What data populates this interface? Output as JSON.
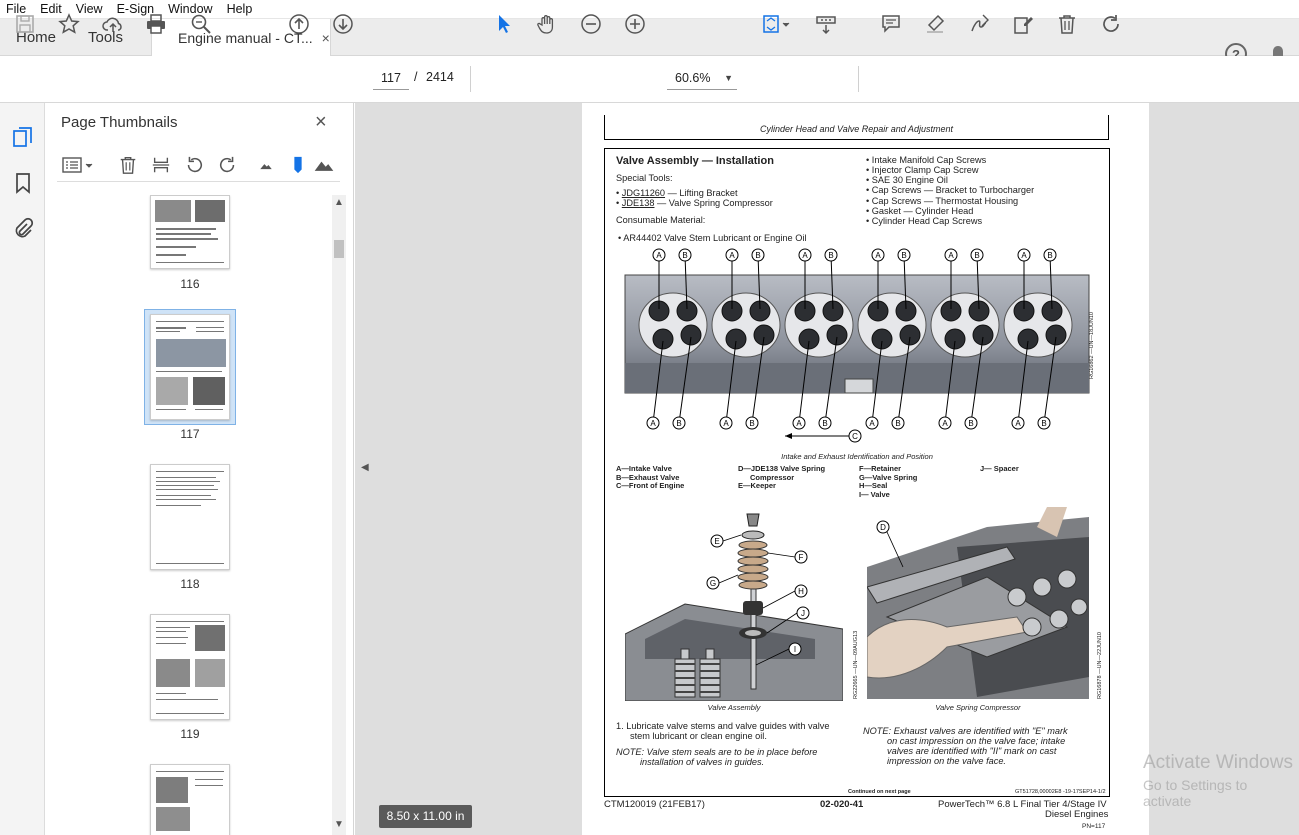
{
  "menu": [
    "File",
    "Edit",
    "View",
    "E-Sign",
    "Window",
    "Help"
  ],
  "tabs": {
    "home": "Home",
    "tools": "Tools",
    "document": "Engine manual - CT...",
    "close": "×"
  },
  "toolbar": {
    "current_page": "117",
    "page_sep": "/",
    "total_pages": "2414",
    "zoom": "60.6%"
  },
  "panel": {
    "title": "Page Thumbnails",
    "close": "×",
    "thumbnails": [
      {
        "label": "116",
        "selected": false
      },
      {
        "label": "117",
        "selected": true
      },
      {
        "label": "118",
        "selected": false
      },
      {
        "label": "119",
        "selected": false
      }
    ]
  },
  "viewer": {
    "page_size": "8.50 x 11.00 in"
  },
  "document": {
    "header": "Cylinder Head and Valve Repair and Adjustment",
    "section_title": "Valve Assembly — Installation",
    "special_tools_label": "Special Tools:",
    "tools": [
      {
        "code": "JDG11260",
        "desc": " — Lifting Bracket"
      },
      {
        "code": "JDE138",
        "desc": " — Valve Spring Compressor"
      }
    ],
    "consumable_label": "Consumable Material:",
    "consumable": "• AR44402 Valve Stem Lubricant or Engine Oil",
    "right_list": [
      "Intake Manifold Cap Screws",
      "Injector Clamp Cap Screw",
      "SAE 30 Engine Oil",
      "Cap Screws — Bracket to Turbocharger",
      "Cap Screws — Thermostat Housing",
      "Gasket — Cylinder Head",
      "Cylinder Head Cap Screws"
    ],
    "fig1_caption": "Intake and Exhaust Identification and Position",
    "fig1_side": "RG16862 —UN—18JUN10",
    "legend_col1": [
      "A—Intake Valve",
      "B—Exhaust Valve",
      "C—Front of Engine"
    ],
    "legend_col2": [
      "D—JDE138 Valve Spring",
      "Compressor",
      "E—Keeper"
    ],
    "legend_col3": [
      "F—Retainer",
      "G—Valve Spring",
      "H—Seal",
      "I— Valve"
    ],
    "legend_col4": [
      "J— Spacer"
    ],
    "fig2_caption": "Valve Assembly",
    "fig2_side": "RG22665 —UN—09AUG13",
    "fig3_caption": "Valve Spring Compressor",
    "fig3_side": "RG16878 —UN—22JUN10",
    "step1_a": "1.  Lubricate valve stems and valve guides with valve",
    "step1_b": "stem lubricant or clean engine oil.",
    "note1_a": "NOTE: Valve stem seals are to be in place before",
    "note1_b": "installation of valves in guides.",
    "note2_a": "NOTE: Exhaust valves are identified with \"E\" mark",
    "note2_b": "on cast impression on the valve face; intake",
    "note2_c": "valves are identified with \"II\" mark on cast",
    "note2_d": "impression on the valve face.",
    "continued": "Continued on next page",
    "ref_code": "GT51728,00002E8 -19-17SEP14-1/2",
    "foot_left": "CTM120019 (21FEB17)",
    "foot_center": "02-020-41",
    "foot_right": "PowerTech™ 6.8 L Final Tier 4/Stage IV",
    "foot_right2": "Diesel Engines",
    "foot_page": "PN=117",
    "callouts_top": [
      "A",
      "B",
      "A",
      "B",
      "A",
      "B",
      "A",
      "B",
      "A",
      "B",
      "A",
      "B"
    ],
    "callouts_bottom": [
      "A",
      "B",
      "A",
      "B",
      "A",
      "B",
      "A",
      "B",
      "A",
      "B",
      "A",
      "B"
    ],
    "callout_c": "C"
  },
  "watermark": {
    "line1": "Activate Windows",
    "line2": "Go to Settings to activate"
  }
}
